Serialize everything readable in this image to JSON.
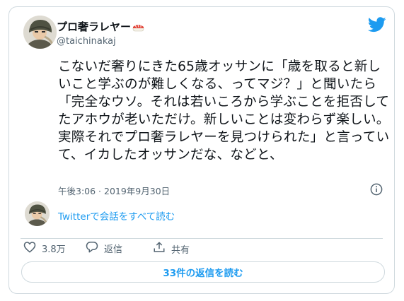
{
  "author": {
    "display_name": "プロ奢ラレヤー",
    "handle": "@taichinakaj"
  },
  "tweet": {
    "text": "こないだ奢りにきた65歳オッサンに「歳を取ると新しいこと学ぶのが難しくなる、ってマジ？」と聞いたら「完全なウソ。それは若いころから学ぶことを拒否してたアホウが老いただけ。新しいことは変わらず楽しい。実際それでプロ奢ラレヤーを見つけられた」と言っていて、イカしたオッサンだな、などと、",
    "timestamp": "午後3:06 · 2019年9月30日"
  },
  "conversation_link": "Twitterで会話をすべて読む",
  "actions": {
    "like_count": "3.8万",
    "reply_label": "返信",
    "share_label": "共有"
  },
  "read_replies_button": "33件の返信を読む",
  "icons": {
    "brand": "twitter-bird-icon",
    "info": "info-icon",
    "like": "heart-icon",
    "reply": "speech-bubble-icon",
    "share": "share-upload-icon",
    "name_emoji": "sushi-icon"
  },
  "colors": {
    "accent": "#1d9bf0",
    "text": "#0f1419",
    "secondary": "#536471",
    "border": "#cfd9de"
  }
}
